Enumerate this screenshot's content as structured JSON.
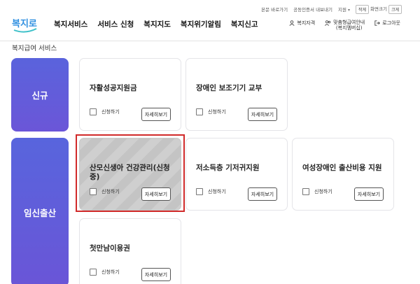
{
  "util": {
    "skip": "본문 바로가기",
    "cert": "공동인증서 내보내기",
    "region": "지원",
    "zoom_label": "화면크기",
    "small": "작게",
    "large": "크게"
  },
  "logo": {
    "text": "복지로"
  },
  "nav": [
    "복지서비스",
    "서비스 신청",
    "복지지도",
    "복지위기알림",
    "복지신고"
  ],
  "header_right": {
    "check": "복지자격",
    "custom_line1": "맞춤형급여안내",
    "custom_line2": "(복지멤버십)",
    "logout": "로그아웃"
  },
  "page_title": "복지급여 서비스",
  "categories": [
    {
      "name": "신규",
      "cards": [
        {
          "title": "자활성공지원금",
          "check_label": "신청하기",
          "detail_label": "자세히보기",
          "selected": false
        },
        {
          "title": "장애인 보조기기 교부",
          "check_label": "신청하기",
          "detail_label": "자세히보기",
          "selected": false
        }
      ]
    },
    {
      "name": "임신출산",
      "cards": [
        {
          "title": "산모신생아 건강관리(신청중)",
          "check_label": "신청하기",
          "detail_label": "자세히보기",
          "selected": true
        },
        {
          "title": "저소득층 기저귀지원",
          "check_label": "신청하기",
          "detail_label": "자세히보기",
          "selected": false
        },
        {
          "title": "여성장애인 출산비용 지원",
          "check_label": "신청하기",
          "detail_label": "자세히보기",
          "selected": false
        },
        {
          "title": "첫만남이용권",
          "check_label": "신청하기",
          "detail_label": "자세히보기",
          "selected": false
        }
      ]
    }
  ],
  "colors": {
    "category_panel": "#5a63dc",
    "highlight_border": "#d12a2a",
    "logo_blue": "#2f8fe0"
  }
}
